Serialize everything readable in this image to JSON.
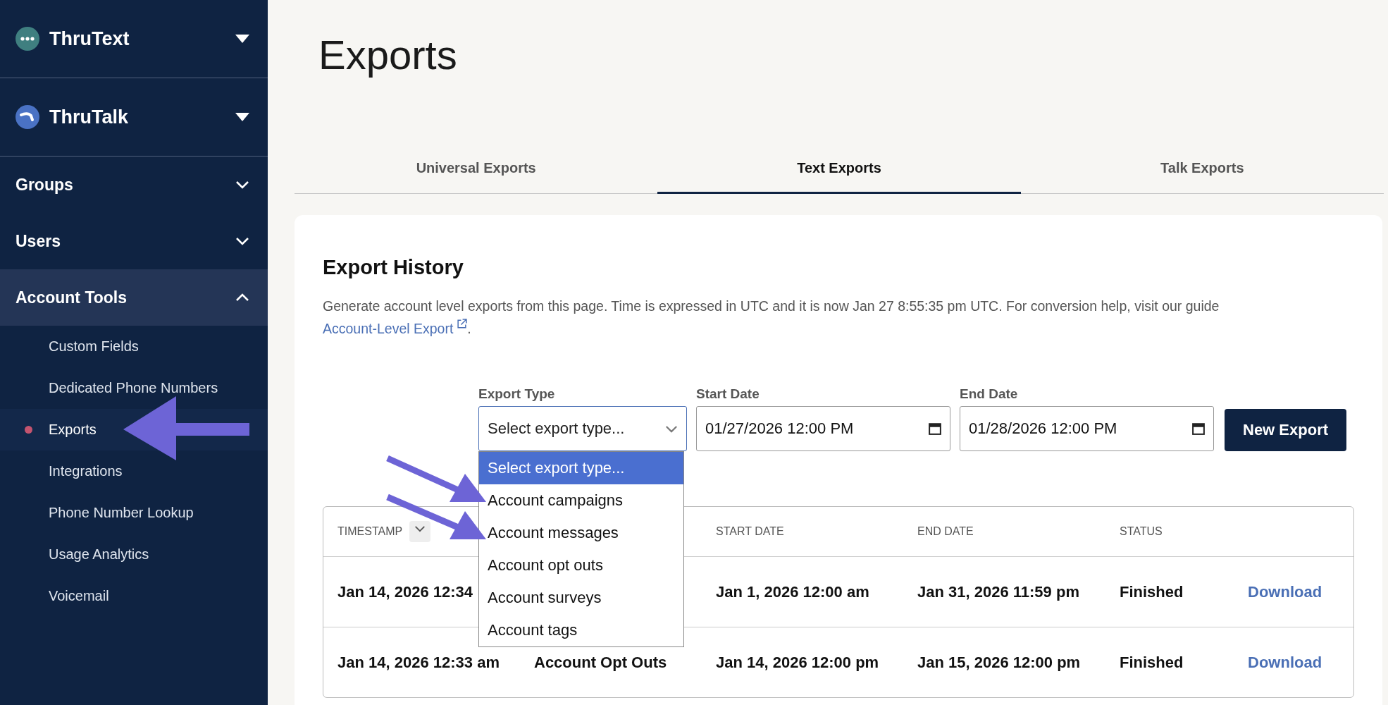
{
  "sidebar": {
    "products": [
      {
        "name": "ThruText",
        "kind": "text",
        "color": "#3f7f80"
      },
      {
        "name": "ThruTalk",
        "kind": "talk",
        "color": "#4a72c4"
      }
    ],
    "sections": [
      {
        "label": "Groups",
        "expanded": false
      },
      {
        "label": "Users",
        "expanded": false
      },
      {
        "label": "Account Tools",
        "expanded": true,
        "items": [
          {
            "label": "Custom Fields",
            "selected": false
          },
          {
            "label": "Dedicated Phone Numbers",
            "selected": false
          },
          {
            "label": "Exports",
            "selected": true
          },
          {
            "label": "Integrations",
            "selected": false
          },
          {
            "label": "Phone Number Lookup",
            "selected": false
          },
          {
            "label": "Usage Analytics",
            "selected": false
          },
          {
            "label": "Voicemail",
            "selected": false
          }
        ]
      }
    ]
  },
  "page": {
    "title": "Exports"
  },
  "tabs": [
    {
      "label": "Universal Exports",
      "selected": false
    },
    {
      "label": "Text Exports",
      "selected": true
    },
    {
      "label": "Talk Exports",
      "selected": false
    }
  ],
  "card": {
    "title": "Export History",
    "description": "Generate account level exports from this page. Time is expressed in UTC and it is now Jan 27 8:55:35 pm UTC. For conversion help, visit our guide",
    "link": "Account-Level Export",
    "after_link": "."
  },
  "form": {
    "export_type": {
      "label": "Export Type",
      "value": "Select export type...",
      "options": [
        {
          "label": "Select export type...",
          "selected": true
        },
        {
          "label": "Account campaigns",
          "selected": false
        },
        {
          "label": "Account messages",
          "selected": false
        },
        {
          "label": "Account opt outs",
          "selected": false
        },
        {
          "label": "Account surveys",
          "selected": false
        },
        {
          "label": "Account tags",
          "selected": false
        }
      ]
    },
    "start_date": {
      "label": "Start Date",
      "value": "01/27/2026 12:00 PM"
    },
    "end_date": {
      "label": "End Date",
      "value": "01/28/2026 12:00 PM"
    },
    "button": "New Export"
  },
  "table": {
    "columns": {
      "timestamp": "TIMESTAMP",
      "start_date": "START DATE",
      "end_date": "END DATE",
      "status": "STATUS"
    },
    "rows": [
      {
        "timestamp": "Jan 14, 2026 12:34",
        "start_date": "Jan 1, 2026 12:00 am",
        "end_date": "Jan 31, 2026 11:59 pm",
        "status": "Finished",
        "action": "Download"
      },
      {
        "timestamp": "Jan 14, 2026 12:33 am",
        "type": "Account Opt Outs",
        "start_date": "Jan 14, 2026 12:00 pm",
        "end_date": "Jan 15, 2026 12:00 pm",
        "status": "Finished",
        "action": "Download"
      }
    ]
  }
}
